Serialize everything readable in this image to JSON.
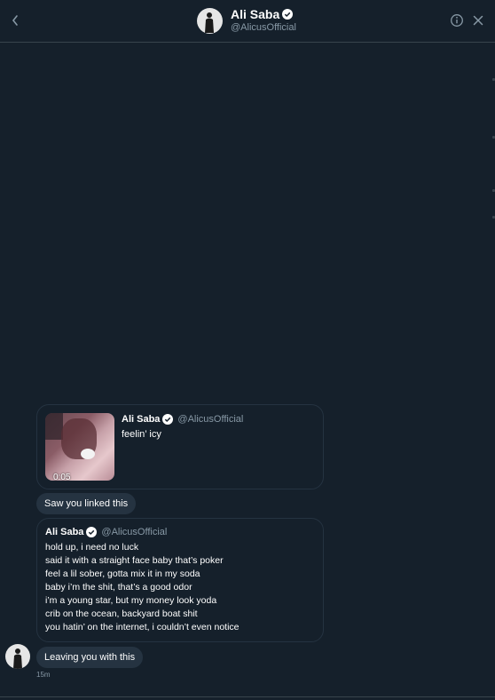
{
  "header": {
    "name": "Ali Saba",
    "handle": "@AlicusOfficial"
  },
  "icons": {
    "back": "chevron-left-icon",
    "info": "info-icon",
    "close": "close-icon",
    "verified": "verified-badge-icon"
  },
  "colors": {
    "background": "#15202b",
    "bubble": "#253341",
    "border": "#38444d",
    "muted": "#8899a6"
  },
  "tweet1": {
    "name": "Ali Saba",
    "handle": "@AlicusOfficial",
    "text": "feelin’ icy",
    "duration": "0:05"
  },
  "message1": "Saw you linked this",
  "tweet2": {
    "name": "Ali Saba",
    "handle": "@AlicusOfficial",
    "lines": [
      "hold up, i need no luck",
      "said it with a straight face baby that’s poker",
      "feel a lil sober, gotta mix it in my soda",
      "baby i’m the shit, that’s a good odor",
      "i’m a young star, but my money look yoda",
      "crib on the ocean, backyard boat shit",
      "you hatin’ on the internet, i couldn’t even notice"
    ]
  },
  "message2": "Leaving you with this",
  "timestamp": "15m"
}
